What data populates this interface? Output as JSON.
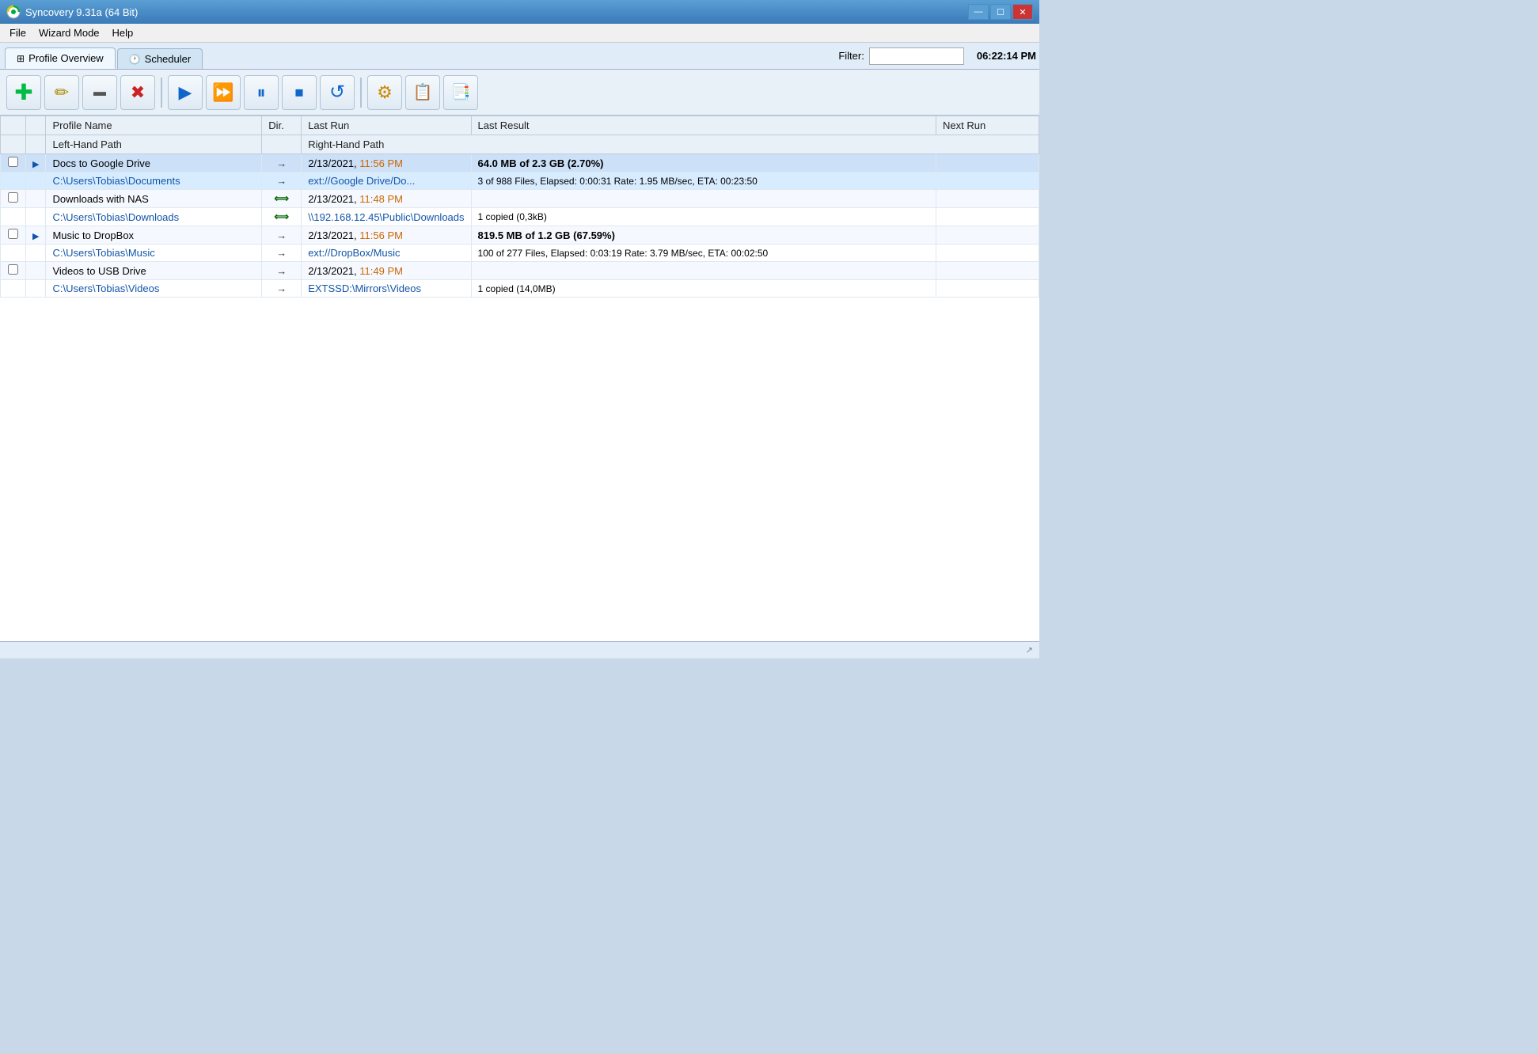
{
  "titleBar": {
    "title": "Syncovery 9.31a (64 Bit)",
    "logoColor": "#00aa44",
    "controls": [
      "—",
      "☐",
      "✕"
    ]
  },
  "menuBar": {
    "items": [
      "File",
      "Wizard Mode",
      "Help"
    ]
  },
  "tabs": [
    {
      "id": "profile-overview",
      "label": "Profile Overview",
      "active": true,
      "icon": "grid"
    },
    {
      "id": "scheduler",
      "label": "Scheduler",
      "active": false,
      "icon": "clock"
    }
  ],
  "filter": {
    "label": "Filter:",
    "placeholder": "",
    "value": ""
  },
  "clock": {
    "time": "06:22:14 PM"
  },
  "toolbar": {
    "buttons": [
      {
        "id": "add",
        "icon": "➕",
        "label": "Add Profile",
        "color": "#00aa44"
      },
      {
        "id": "edit",
        "icon": "✏️",
        "label": "Edit Profile"
      },
      {
        "id": "rename",
        "icon": "▬",
        "label": "Rename"
      },
      {
        "id": "delete",
        "icon": "✖",
        "label": "Delete",
        "color": "#cc2222"
      },
      {
        "id": "run",
        "icon": "▶",
        "label": "Run",
        "color": "#2266cc"
      },
      {
        "id": "run-all",
        "icon": "⏩",
        "label": "Run All",
        "color": "#2266cc"
      },
      {
        "id": "pause",
        "icon": "⏸",
        "label": "Pause",
        "color": "#2266cc"
      },
      {
        "id": "stop",
        "icon": "⏹",
        "label": "Stop",
        "color": "#2266cc"
      },
      {
        "id": "refresh",
        "icon": "↺",
        "label": "Refresh",
        "color": "#2266cc"
      },
      {
        "id": "settings",
        "icon": "⚙",
        "label": "Settings",
        "color": "#cc8800"
      },
      {
        "id": "log",
        "icon": "📋",
        "label": "Log"
      },
      {
        "id": "copy",
        "icon": "📑",
        "label": "Copy"
      }
    ]
  },
  "tableHeaders": {
    "col1": "",
    "col2": "",
    "profileName": "Profile Name",
    "leftPath": "Left-Hand Path",
    "dir": "Dir.",
    "lastRun": "Last Run",
    "rightPath": "Right-Hand Path",
    "lastResult": "Last Result",
    "nextRun": "Next Run"
  },
  "profiles": [
    {
      "id": 1,
      "checked": false,
      "hasPlay": true,
      "name": "Docs to Google Drive",
      "leftPath": "C:\\Users\\Tobias\\Documents",
      "dir": "→",
      "dirType": "right",
      "lastRun": "2/13/2021,",
      "lastRunTime": "11:56 PM",
      "rightPath": "ext://Google Drive/Do...",
      "lastResultBold": "64.0 MB of 2.3 GB (2.70%)",
      "lastResultSub": "3 of 988 Files, Elapsed: 0:00:31  Rate: 1.95 MB/sec, ETA: 00:23:50",
      "nextRun": "",
      "selected": true
    },
    {
      "id": 2,
      "checked": false,
      "hasPlay": false,
      "name": "Downloads with NAS",
      "leftPath": "C:\\Users\\Tobias\\Downloads",
      "dir": "⟺",
      "dirType": "both",
      "lastRun": "2/13/2021,",
      "lastRunTime": "11:48 PM",
      "rightPath": "\\\\192.168.12.45\\Public\\Downloads",
      "lastResultBold": "",
      "lastResultSub": "1 copied (0,3kB)",
      "nextRun": "",
      "selected": false
    },
    {
      "id": 3,
      "checked": false,
      "hasPlay": true,
      "name": "Music to DropBox",
      "leftPath": "C:\\Users\\Tobias\\Music",
      "dir": "→",
      "dirType": "right",
      "lastRun": "2/13/2021,",
      "lastRunTime": "11:56 PM",
      "rightPath": "ext://DropBox/Music",
      "lastResultBold": "819.5 MB of 1.2 GB (67.59%)",
      "lastResultSub": "100 of 277 Files, Elapsed: 0:03:19  Rate: 3.79 MB/sec, ETA: 00:02:50",
      "nextRun": "",
      "selected": false
    },
    {
      "id": 4,
      "checked": false,
      "hasPlay": false,
      "name": "Videos to USB Drive",
      "leftPath": "C:\\Users\\Tobias\\Videos",
      "dir": "→",
      "dirType": "right",
      "lastRun": "2/13/2021,",
      "lastRunTime": "11:49 PM",
      "rightPath": "EXTSSD:\\Mirrors\\Videos",
      "lastResultBold": "",
      "lastResultSub": "1 copied (14,0MB)",
      "nextRun": "",
      "selected": false
    }
  ],
  "statusBar": {
    "left": "",
    "right": "↗"
  }
}
